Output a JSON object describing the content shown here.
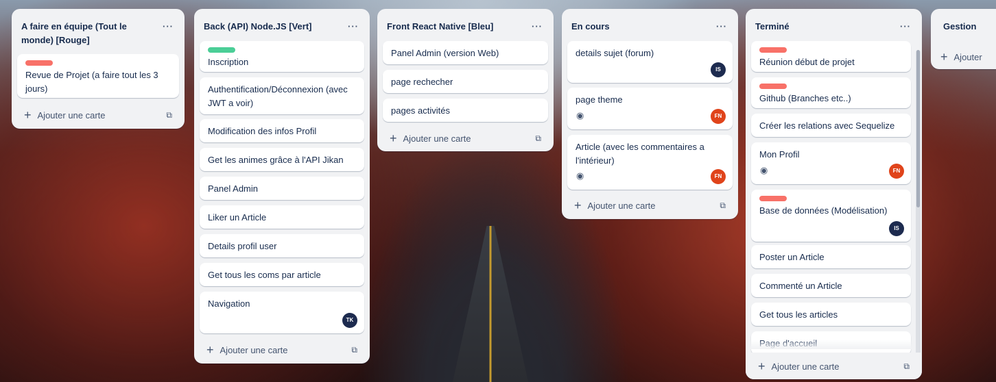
{
  "lists": [
    {
      "title": "A faire en équipe (Tout le monde) [Rouge]",
      "menu": "···",
      "cards": [
        {
          "label": "red",
          "text": "Revue de Projet (a faire tout les 3 jours)"
        }
      ],
      "add_label": "Ajouter une carte"
    },
    {
      "title": "Back (API) Node.JS [Vert]",
      "menu": "···",
      "cards": [
        {
          "label": "green",
          "text": "Inscription"
        },
        {
          "text": "Authentification/Déconnexion (avec JWT a voir)"
        },
        {
          "text": "Modification des infos Profil"
        },
        {
          "text": "Get les animes grâce à l'API Jikan"
        },
        {
          "text": "Panel Admin"
        },
        {
          "text": "Liker un Article"
        },
        {
          "text": "Details profil user"
        },
        {
          "text": "Get tous les coms par article"
        },
        {
          "text": "Navigation",
          "avatar": "TK"
        }
      ],
      "add_label": "Ajouter une carte"
    },
    {
      "title": "Front React Native [Bleu]",
      "menu": "···",
      "cards": [
        {
          "text": "Panel Admin (version Web)"
        },
        {
          "text": "page rechecher"
        },
        {
          "text": "pages activités"
        }
      ],
      "add_label": "Ajouter une carte"
    },
    {
      "title": "En cours",
      "menu": "···",
      "cards": [
        {
          "text": "details sujet (forum)",
          "avatar": "IS"
        },
        {
          "text": "page theme",
          "watch": true,
          "avatar": "FN"
        },
        {
          "text": "Article (avec les commentaires a l'intérieur)",
          "watch": true,
          "avatar": "FN"
        }
      ],
      "add_label": "Ajouter une carte"
    },
    {
      "title": "Terminé",
      "menu": "···",
      "cards": [
        {
          "label": "red",
          "text": "Réunion début de projet"
        },
        {
          "label": "red",
          "text": "Github (Branches etc..)"
        },
        {
          "text": "Créer les relations avec Sequelize"
        },
        {
          "text": "Mon Profil",
          "watch": true,
          "avatar": "FN"
        },
        {
          "label": "red",
          "text": "Base de données (Modélisation)",
          "avatar": "IS"
        },
        {
          "text": "Poster un Article"
        },
        {
          "text": "Commenté un Article"
        },
        {
          "text": "Get tous les articles"
        },
        {
          "text": "Page d'accueil"
        }
      ],
      "add_label": "Ajouter une carte"
    },
    {
      "title": "Gestion",
      "add_label": "Ajouter"
    }
  ],
  "colors": {
    "label_red": "#f87168",
    "label_green": "#4bce97",
    "avatar_navy": "#1d2b4f",
    "avatar_orange": "#e0441b",
    "list_bg": "#f1f2f4"
  },
  "icons": {
    "add": "plus-icon",
    "template": "card-template-icon",
    "watch": "eye-icon",
    "menu": "more-icon"
  }
}
